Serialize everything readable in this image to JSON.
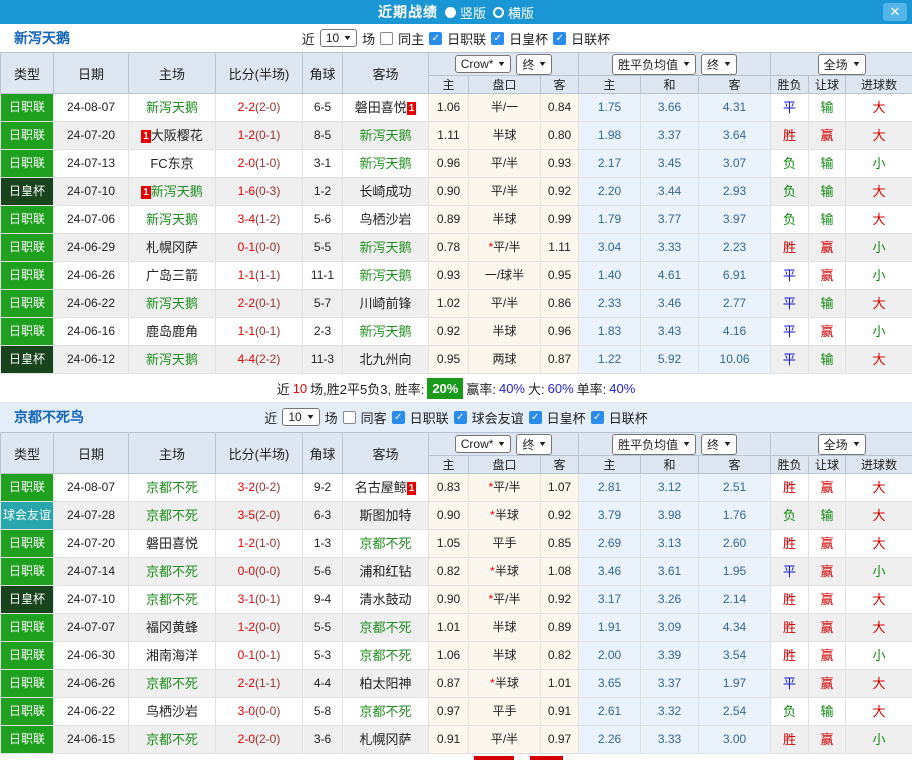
{
  "window": {
    "title": "近期战绩",
    "close_label": "✕",
    "layout_options": [
      {
        "label": "竖版",
        "selected": true
      },
      {
        "label": "横版",
        "selected": false
      }
    ]
  },
  "colors": {
    "titlebar": "#1a96d4",
    "leagues": {
      "日职联": "#1fa11f",
      "日皇杯": "#17431d",
      "球会友谊": "#27a7ab"
    },
    "team_highlight": "#1e8e1e",
    "result_win": "#d40000",
    "result_draw": "#1515cc",
    "result_loss": "#0f8a0f",
    "rate_badge": "#1a9a1a",
    "score": "#e60000"
  },
  "header": {
    "main_cols": [
      "类型",
      "日期",
      "主场",
      "比分(半场)",
      "角球",
      "客场"
    ],
    "odds_group": {
      "bookmaker": "Crow*",
      "stage": "终",
      "cols": [
        "主",
        "盘口",
        "客"
      ]
    },
    "avg_group": {
      "label": "胜平负均值",
      "stage": "终",
      "cols": [
        "主",
        "和",
        "客"
      ]
    },
    "result_group": {
      "scope": "全场",
      "cols": [
        "胜负",
        "让球",
        "进球数"
      ]
    }
  },
  "tables": [
    {
      "team": "新泻天鹅",
      "filter": {
        "near_label": "近",
        "count": "10",
        "unit_label": "场",
        "same_label": "同主",
        "same_checked": false,
        "leagues": [
          {
            "label": "日职联",
            "checked": true
          },
          {
            "label": "日皇杯",
            "checked": true
          },
          {
            "label": "日联杯",
            "checked": true
          }
        ]
      },
      "rows": [
        {
          "league": "日职联",
          "date": "24-08-07",
          "home": {
            "name": "新泻天鹅",
            "hl": true
          },
          "score": "2-2",
          "half": "(2-0)",
          "corners": "6-5",
          "away": {
            "name": "磐田喜悦",
            "post": "1"
          },
          "crow_home": "1.06",
          "line": "半/一",
          "crow_away": "0.84",
          "avg_home": "1.75",
          "avg_draw": "3.66",
          "avg_away": "4.31",
          "res_wdl": "平",
          "res_line": "输",
          "res_goal": "大"
        },
        {
          "league": "日职联",
          "date": "24-07-20",
          "home": {
            "name": "大阪樱花",
            "pre": "1"
          },
          "score": "1-2",
          "half": "(0-1)",
          "corners": "8-5",
          "away": {
            "name": "新泻天鹅",
            "hl": true
          },
          "crow_home": "1.11",
          "line": "半球",
          "crow_away": "0.80",
          "avg_home": "1.98",
          "avg_draw": "3.37",
          "avg_away": "3.64",
          "res_wdl": "胜",
          "res_line": "赢",
          "res_goal": "大"
        },
        {
          "league": "日职联",
          "date": "24-07-13",
          "home": {
            "name": "FC东京"
          },
          "score": "2-0",
          "half": "(1-0)",
          "corners": "3-1",
          "away": {
            "name": "新泻天鹅",
            "hl": true
          },
          "crow_home": "0.96",
          "line": "平/半",
          "crow_away": "0.93",
          "avg_home": "2.17",
          "avg_draw": "3.45",
          "avg_away": "3.07",
          "res_wdl": "负",
          "res_line": "输",
          "res_goal": "小"
        },
        {
          "league": "日皇杯",
          "date": "24-07-10",
          "home": {
            "name": "新泻天鹅",
            "hl": true,
            "pre": "1"
          },
          "score": "1-6",
          "half": "(0-3)",
          "corners": "1-2",
          "away": {
            "name": "长崎成功"
          },
          "crow_home": "0.90",
          "line": "平/半",
          "crow_away": "0.92",
          "avg_home": "2.20",
          "avg_draw": "3.44",
          "avg_away": "2.93",
          "res_wdl": "负",
          "res_line": "输",
          "res_goal": "大"
        },
        {
          "league": "日职联",
          "date": "24-07-06",
          "home": {
            "name": "新泻天鹅",
            "hl": true
          },
          "score": "3-4",
          "half": "(1-2)",
          "corners": "5-6",
          "away": {
            "name": "鸟栖沙岩"
          },
          "crow_home": "0.89",
          "line": "半球",
          "crow_away": "0.99",
          "avg_home": "1.79",
          "avg_draw": "3.77",
          "avg_away": "3.97",
          "res_wdl": "负",
          "res_line": "输",
          "res_goal": "大"
        },
        {
          "league": "日职联",
          "date": "24-06-29",
          "home": {
            "name": "札幌冈萨"
          },
          "score": "0-1",
          "half": "(0-0)",
          "corners": "5-5",
          "away": {
            "name": "新泻天鹅",
            "hl": true
          },
          "crow_home": "0.78",
          "line": "平/半",
          "line_star": true,
          "crow_away": "1.11",
          "avg_home": "3.04",
          "avg_draw": "3.33",
          "avg_away": "2.23",
          "res_wdl": "胜",
          "res_line": "赢",
          "res_goal": "小"
        },
        {
          "league": "日职联",
          "date": "24-06-26",
          "home": {
            "name": "广岛三箭"
          },
          "score": "1-1",
          "half": "(1-1)",
          "corners": "11-1",
          "away": {
            "name": "新泻天鹅",
            "hl": true
          },
          "crow_home": "0.93",
          "line": "一/球半",
          "crow_away": "0.95",
          "avg_home": "1.40",
          "avg_draw": "4.61",
          "avg_away": "6.91",
          "res_wdl": "平",
          "res_line": "赢",
          "res_goal": "小"
        },
        {
          "league": "日职联",
          "date": "24-06-22",
          "home": {
            "name": "新泻天鹅",
            "hl": true
          },
          "score": "2-2",
          "half": "(0-1)",
          "corners": "5-7",
          "away": {
            "name": "川崎前锋"
          },
          "crow_home": "1.02",
          "line": "平/半",
          "crow_away": "0.86",
          "avg_home": "2.33",
          "avg_draw": "3.46",
          "avg_away": "2.77",
          "res_wdl": "平",
          "res_line": "输",
          "res_goal": "大"
        },
        {
          "league": "日职联",
          "date": "24-06-16",
          "home": {
            "name": "鹿岛鹿角"
          },
          "score": "1-1",
          "half": "(0-1)",
          "corners": "2-3",
          "away": {
            "name": "新泻天鹅",
            "hl": true
          },
          "crow_home": "0.92",
          "line": "半球",
          "crow_away": "0.96",
          "avg_home": "1.83",
          "avg_draw": "3.43",
          "avg_away": "4.16",
          "res_wdl": "平",
          "res_line": "赢",
          "res_goal": "小"
        },
        {
          "league": "日皇杯",
          "date": "24-06-12",
          "home": {
            "name": "新泻天鹅",
            "hl": true
          },
          "score": "4-4",
          "half": "(2-2)",
          "corners": "11-3",
          "away": {
            "name": "北九州向"
          },
          "crow_home": "0.95",
          "line": "两球",
          "crow_away": "0.87",
          "avg_home": "1.22",
          "avg_draw": "5.92",
          "avg_away": "10.06",
          "res_wdl": "平",
          "res_line": "输",
          "res_goal": "大"
        }
      ],
      "summary": {
        "near_label": "近",
        "near_count": "10",
        "stats_text": "场,胜2平5负3, 胜率:",
        "rate_badge": "20%",
        "win_label": "赢率:",
        "win_value": "40%",
        "big_label": "大:",
        "big_value": "60%",
        "single_label": "单率:",
        "single_value": "40%"
      }
    },
    {
      "team": "京都不死鸟",
      "filter": {
        "near_label": "近",
        "count": "10",
        "unit_label": "场",
        "same_label": "同客",
        "same_checked": false,
        "leagues": [
          {
            "label": "日职联",
            "checked": true
          },
          {
            "label": "球会友谊",
            "checked": true
          },
          {
            "label": "日皇杯",
            "checked": true
          },
          {
            "label": "日联杯",
            "checked": true
          }
        ]
      },
      "rows": [
        {
          "league": "日职联",
          "date": "24-08-07",
          "home": {
            "name": "京都不死",
            "hl": true
          },
          "score": "3-2",
          "half": "(0-2)",
          "corners": "9-2",
          "away": {
            "name": "名古屋鲸",
            "post": "1"
          },
          "crow_home": "0.83",
          "line": "平/半",
          "line_star": true,
          "crow_away": "1.07",
          "avg_home": "2.81",
          "avg_draw": "3.12",
          "avg_away": "2.51",
          "res_wdl": "胜",
          "res_line": "赢",
          "res_goal": "大"
        },
        {
          "league": "球会友谊",
          "date": "24-07-28",
          "home": {
            "name": "京都不死",
            "hl": true
          },
          "score": "3-5",
          "half": "(2-0)",
          "corners": "6-3",
          "away": {
            "name": "斯图加特"
          },
          "crow_home": "0.90",
          "line": "半球",
          "line_star": true,
          "crow_away": "0.92",
          "avg_home": "3.79",
          "avg_draw": "3.98",
          "avg_away": "1.76",
          "res_wdl": "负",
          "res_line": "输",
          "res_goal": "大"
        },
        {
          "league": "日职联",
          "date": "24-07-20",
          "home": {
            "name": "磐田喜悦"
          },
          "score": "1-2",
          "half": "(1-0)",
          "corners": "1-3",
          "away": {
            "name": "京都不死",
            "hl": true
          },
          "crow_home": "1.05",
          "line": "平手",
          "crow_away": "0.85",
          "avg_home": "2.69",
          "avg_draw": "3.13",
          "avg_away": "2.60",
          "res_wdl": "胜",
          "res_line": "赢",
          "res_goal": "大"
        },
        {
          "league": "日职联",
          "date": "24-07-14",
          "home": {
            "name": "京都不死",
            "hl": true
          },
          "score": "0-0",
          "half": "(0-0)",
          "corners": "5-6",
          "away": {
            "name": "浦和红钻"
          },
          "crow_home": "0.82",
          "line": "半球",
          "line_star": true,
          "crow_away": "1.08",
          "avg_home": "3.46",
          "avg_draw": "3.61",
          "avg_away": "1.95",
          "res_wdl": "平",
          "res_line": "赢",
          "res_goal": "小"
        },
        {
          "league": "日皇杯",
          "date": "24-07-10",
          "home": {
            "name": "京都不死",
            "hl": true
          },
          "score": "3-1",
          "half": "(0-1)",
          "corners": "9-4",
          "away": {
            "name": "清水鼓动"
          },
          "crow_home": "0.90",
          "line": "平/半",
          "line_star": true,
          "crow_away": "0.92",
          "avg_home": "3.17",
          "avg_draw": "3.26",
          "avg_away": "2.14",
          "res_wdl": "胜",
          "res_line": "赢",
          "res_goal": "大"
        },
        {
          "league": "日职联",
          "date": "24-07-07",
          "home": {
            "name": "福冈黄蜂"
          },
          "score": "1-2",
          "half": "(0-0)",
          "corners": "5-5",
          "away": {
            "name": "京都不死",
            "hl": true
          },
          "crow_home": "1.01",
          "line": "半球",
          "crow_away": "0.89",
          "avg_home": "1.91",
          "avg_draw": "3.09",
          "avg_away": "4.34",
          "res_wdl": "胜",
          "res_line": "赢",
          "res_goal": "大"
        },
        {
          "league": "日职联",
          "date": "24-06-30",
          "home": {
            "name": "湘南海洋"
          },
          "score": "0-1",
          "half": "(0-1)",
          "corners": "5-3",
          "away": {
            "name": "京都不死",
            "hl": true
          },
          "crow_home": "1.06",
          "line": "半球",
          "crow_away": "0.82",
          "avg_home": "2.00",
          "avg_draw": "3.39",
          "avg_away": "3.54",
          "res_wdl": "胜",
          "res_line": "赢",
          "res_goal": "小"
        },
        {
          "league": "日职联",
          "date": "24-06-26",
          "home": {
            "name": "京都不死",
            "hl": true
          },
          "score": "2-2",
          "half": "(1-1)",
          "corners": "4-4",
          "away": {
            "name": "柏太阳神"
          },
          "crow_home": "0.87",
          "line": "半球",
          "line_star": true,
          "crow_away": "1.01",
          "avg_home": "3.65",
          "avg_draw": "3.37",
          "avg_away": "1.97",
          "res_wdl": "平",
          "res_line": "赢",
          "res_goal": "大"
        },
        {
          "league": "日职联",
          "date": "24-06-22",
          "home": {
            "name": "鸟栖沙岩"
          },
          "score": "3-0",
          "half": "(0-0)",
          "corners": "5-8",
          "away": {
            "name": "京都不死",
            "hl": true
          },
          "crow_home": "0.97",
          "line": "平手",
          "crow_away": "0.91",
          "avg_home": "2.61",
          "avg_draw": "3.32",
          "avg_away": "2.54",
          "res_wdl": "负",
          "res_line": "输",
          "res_goal": "大"
        },
        {
          "league": "日职联",
          "date": "24-06-15",
          "home": {
            "name": "京都不死",
            "hl": true
          },
          "score": "2-0",
          "half": "(2-0)",
          "corners": "3-6",
          "away": {
            "name": "札幌冈萨"
          },
          "crow_home": "0.91",
          "line": "平/半",
          "crow_away": "0.97",
          "avg_home": "2.26",
          "avg_draw": "3.33",
          "avg_away": "3.00",
          "res_wdl": "胜",
          "res_line": "赢",
          "res_goal": "小"
        }
      ]
    }
  ]
}
